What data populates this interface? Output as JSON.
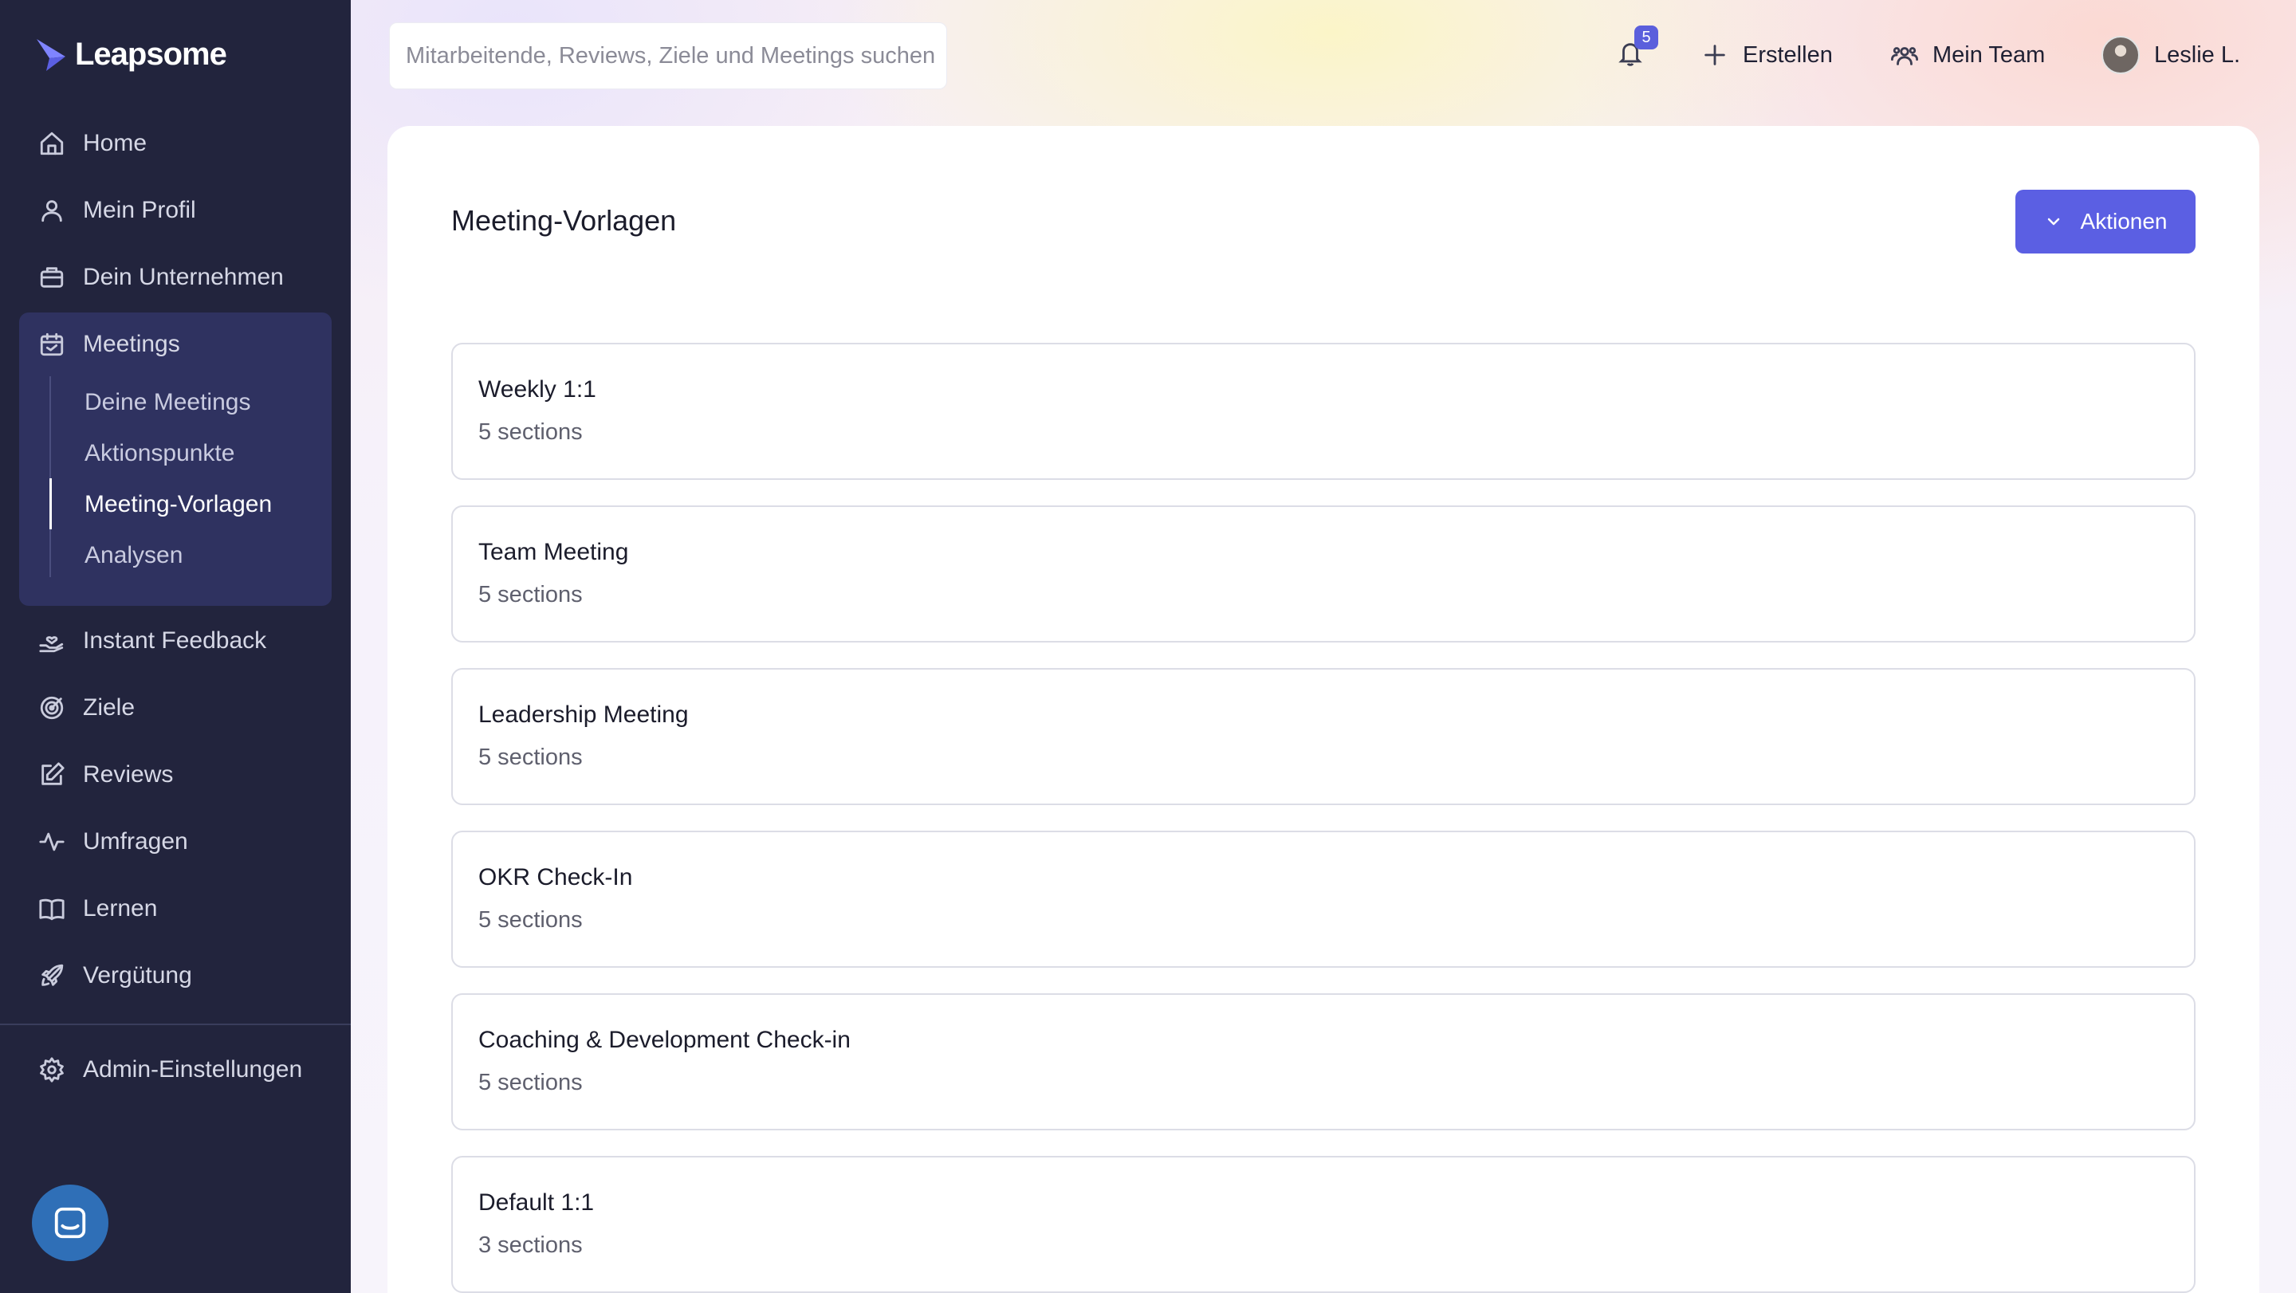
{
  "brand": {
    "name": "Leapsome"
  },
  "sidebar": {
    "items": [
      {
        "label": "Home",
        "icon": "home-icon"
      },
      {
        "label": "Mein Profil",
        "icon": "user-icon"
      },
      {
        "label": "Dein Unternehmen",
        "icon": "briefcase-icon"
      },
      {
        "label": "Meetings",
        "icon": "calendar-icon"
      },
      {
        "label": "Instant Feedback",
        "icon": "hand-heart-icon"
      },
      {
        "label": "Ziele",
        "icon": "target-icon"
      },
      {
        "label": "Reviews",
        "icon": "edit-icon"
      },
      {
        "label": "Umfragen",
        "icon": "activity-icon"
      },
      {
        "label": "Lernen",
        "icon": "book-icon"
      },
      {
        "label": "Vergütung",
        "icon": "rocket-icon"
      }
    ],
    "meetings_sub": [
      {
        "label": "Deine Meetings"
      },
      {
        "label": "Aktionspunkte"
      },
      {
        "label": "Meeting-Vorlagen"
      },
      {
        "label": "Analysen"
      }
    ],
    "admin": {
      "label": "Admin-Einstellungen",
      "icon": "gear-icon"
    },
    "chat_icon": "chat-icon"
  },
  "header": {
    "search_placeholder": "Mitarbeitende, Reviews, Ziele und Meetings suchen",
    "notifications_count": "5",
    "create_label": "Erstellen",
    "team_label": "Mein Team",
    "user_name": "Leslie L."
  },
  "main": {
    "title": "Meeting-Vorlagen",
    "actions_label": "Aktionen",
    "templates": [
      {
        "name": "Weekly 1:1",
        "sections": "5 sections"
      },
      {
        "name": "Team Meeting",
        "sections": "5 sections"
      },
      {
        "name": "Leadership Meeting",
        "sections": "5 sections"
      },
      {
        "name": "OKR Check-In",
        "sections": "5 sections"
      },
      {
        "name": "Coaching & Development Check-in",
        "sections": "5 sections"
      },
      {
        "name": "Default 1:1",
        "sections": "3 sections"
      }
    ]
  },
  "colors": {
    "sidebar_bg": "#22243d",
    "sidebar_active_bg": "#2f3260",
    "accent": "#5b5fe3"
  }
}
